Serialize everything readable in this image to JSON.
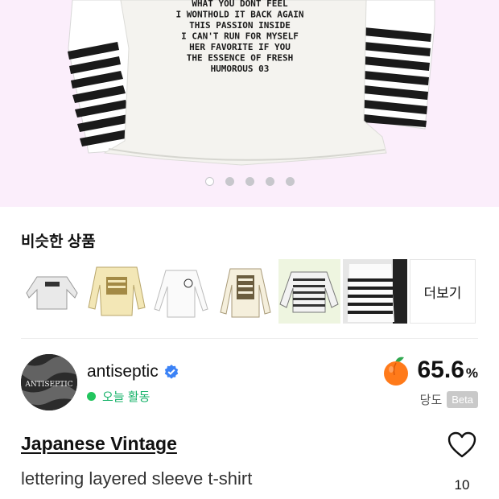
{
  "hero": {
    "shirt_print_lines": [
      "WHAT YOU DONT FEEL",
      "I WONTHOLD IT BACK AGAIN",
      "THIS PASSION INSIDE",
      "I CAN'T RUN FOR MYSELF",
      "HER FAVORITE IF YOU",
      "THE ESSENCE OF FRESH",
      "HUMOROUS 03"
    ],
    "carousel": {
      "count": 5,
      "active_index": 0
    }
  },
  "similar": {
    "title": "비슷한 상품",
    "more_label": "더보기",
    "items": [
      {
        "icon": "gray-longsleeve-thumbnail"
      },
      {
        "icon": "yellow-print-longsleeve-thumbnail"
      },
      {
        "icon": "white-longsleeve-thumbnail"
      },
      {
        "icon": "layered-print-tee-thumbnail"
      },
      {
        "icon": "striped-longsleeve-thumbnail"
      },
      {
        "icon": "striped-tee-hanger-thumbnail"
      }
    ]
  },
  "seller": {
    "name": "antiseptic",
    "avatar_text": "ANTISEPTIC",
    "activity": "오늘 활동",
    "verified_icon": "verified-check-icon"
  },
  "rating": {
    "value": "65.6",
    "unit": "%",
    "label": "당도",
    "badge": "Beta",
    "icon": "peach-icon"
  },
  "product": {
    "brand": "Japanese Vintage",
    "title": "lettering layered sleeve t-shirt",
    "likes": "10"
  },
  "colors": {
    "hero_bg": "#fbeefb",
    "activity_green": "#22c55e",
    "verified_blue": "#3b82f6",
    "peach_orange": "#ff7a1a"
  }
}
